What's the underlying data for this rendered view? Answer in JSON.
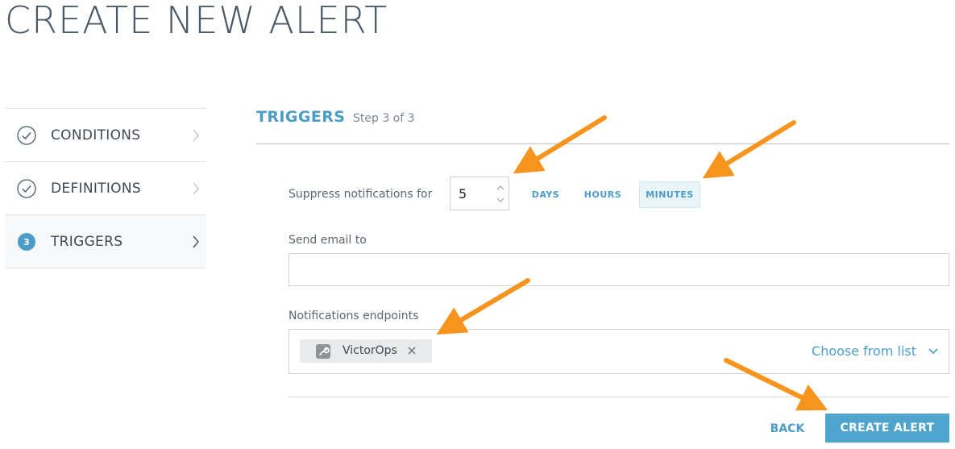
{
  "page": {
    "title": "CREATE NEW ALERT"
  },
  "sidebar": {
    "items": [
      {
        "label": "CONDITIONS",
        "state": "done",
        "icon": "check-circle-icon"
      },
      {
        "label": "DEFINITIONS",
        "state": "done",
        "icon": "check-circle-icon"
      },
      {
        "label": "TRIGGERS",
        "state": "active",
        "number": "3"
      }
    ]
  },
  "step": {
    "title": "TRIGGERS",
    "subtitle": "Step 3 of 3"
  },
  "suppress": {
    "label": "Suppress notifications for",
    "value": "5",
    "units": [
      "DAYS",
      "HOURS",
      "MINUTES"
    ],
    "selected_unit": "MINUTES"
  },
  "email": {
    "label": "Send email to",
    "value": ""
  },
  "endpoints": {
    "label": "Notifications endpoints",
    "selected": [
      {
        "name": "VictorOps",
        "icon": "wrench-icon"
      }
    ],
    "choose_label": "Choose from list"
  },
  "actions": {
    "back_label": "BACK",
    "create_label": "CREATE ALERT"
  },
  "colors": {
    "accent": "#4b9dc8",
    "annotation_arrow": "#f7941d"
  }
}
